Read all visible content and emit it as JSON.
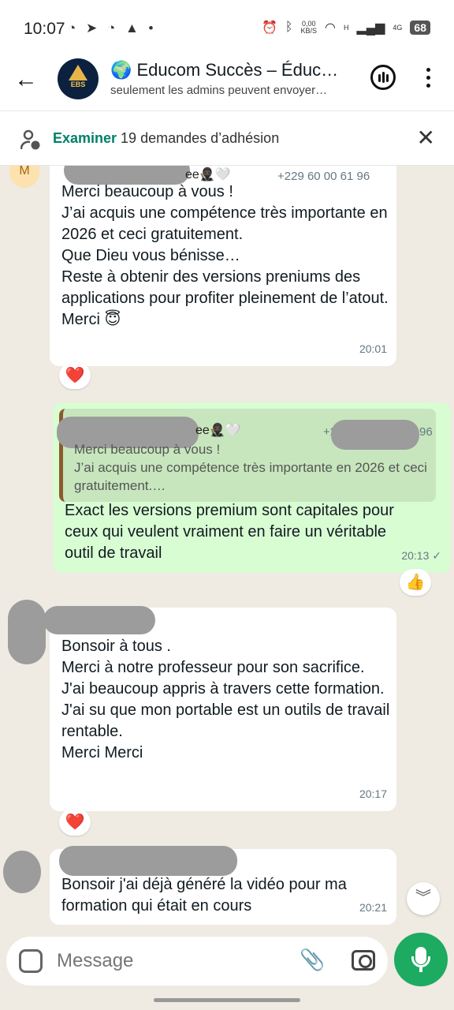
{
  "status_bar": {
    "time": "10:07",
    "left_icons": "◔ ➤ ◔ ▲ •",
    "data_rate_top": "0,00",
    "data_rate_bottom": "KB/S",
    "net1": "H",
    "net2": "4G",
    "battery": "68"
  },
  "header": {
    "back_icon": "←",
    "avatar_text": "EBS",
    "title": "🌍 Educom Succès – Éduc…",
    "subtitle": "seulement les admins peuvent envoyer…"
  },
  "join_banner": {
    "action": "Examiner",
    "text": " 19 demandes d’adhésion",
    "close_icon": "✕"
  },
  "messages": [
    {
      "avatar_letter": "M",
      "sender_suffix": "ee🥷🏿🤍",
      "phone": "+229 60 00 61 96",
      "text": "Merci beaucoup à vous !\nJ’ai acquis une compétence très importante en 2026 et ceci gratuitement.\nQue Dieu vous bénisse…\nReste à obtenir des versions preniums des applications pour profiter pleinement de l’atout.\nMerci 😇",
      "time": "20:01",
      "reaction": "❤️"
    },
    {
      "quote_sender_suffix": "ee🥷🏿🤍",
      "quote_phone_prefix": "+2",
      "quote_phone_suffix": "96",
      "quote_text": "Merci beaucoup à vous !\nJ’ai acquis une compétence très importante en 2026 et ceci gratuitement.…",
      "text": "Exact les versions premium sont capitales pour ceux qui veulent vraiment en faire un véritable outil de travail",
      "time": "20:13 ✓",
      "reaction": "👍"
    },
    {
      "text": "Bonsoir à tous .\nMerci à notre professeur pour son sacrifice.\nJ'ai beaucoup appris à travers cette formation.\nJ'ai su que mon portable est un outils de travail rentable.\nMerci Merci",
      "time": "20:17",
      "reaction": "❤️"
    },
    {
      "text": "Bonsoir j'ai déjà généré la vidéo pour ma formation qui était en cours",
      "time": "20:21"
    }
  ],
  "scroll_down_icon": "︾",
  "composer": {
    "placeholder": "Message",
    "attach_icon": "📎"
  }
}
